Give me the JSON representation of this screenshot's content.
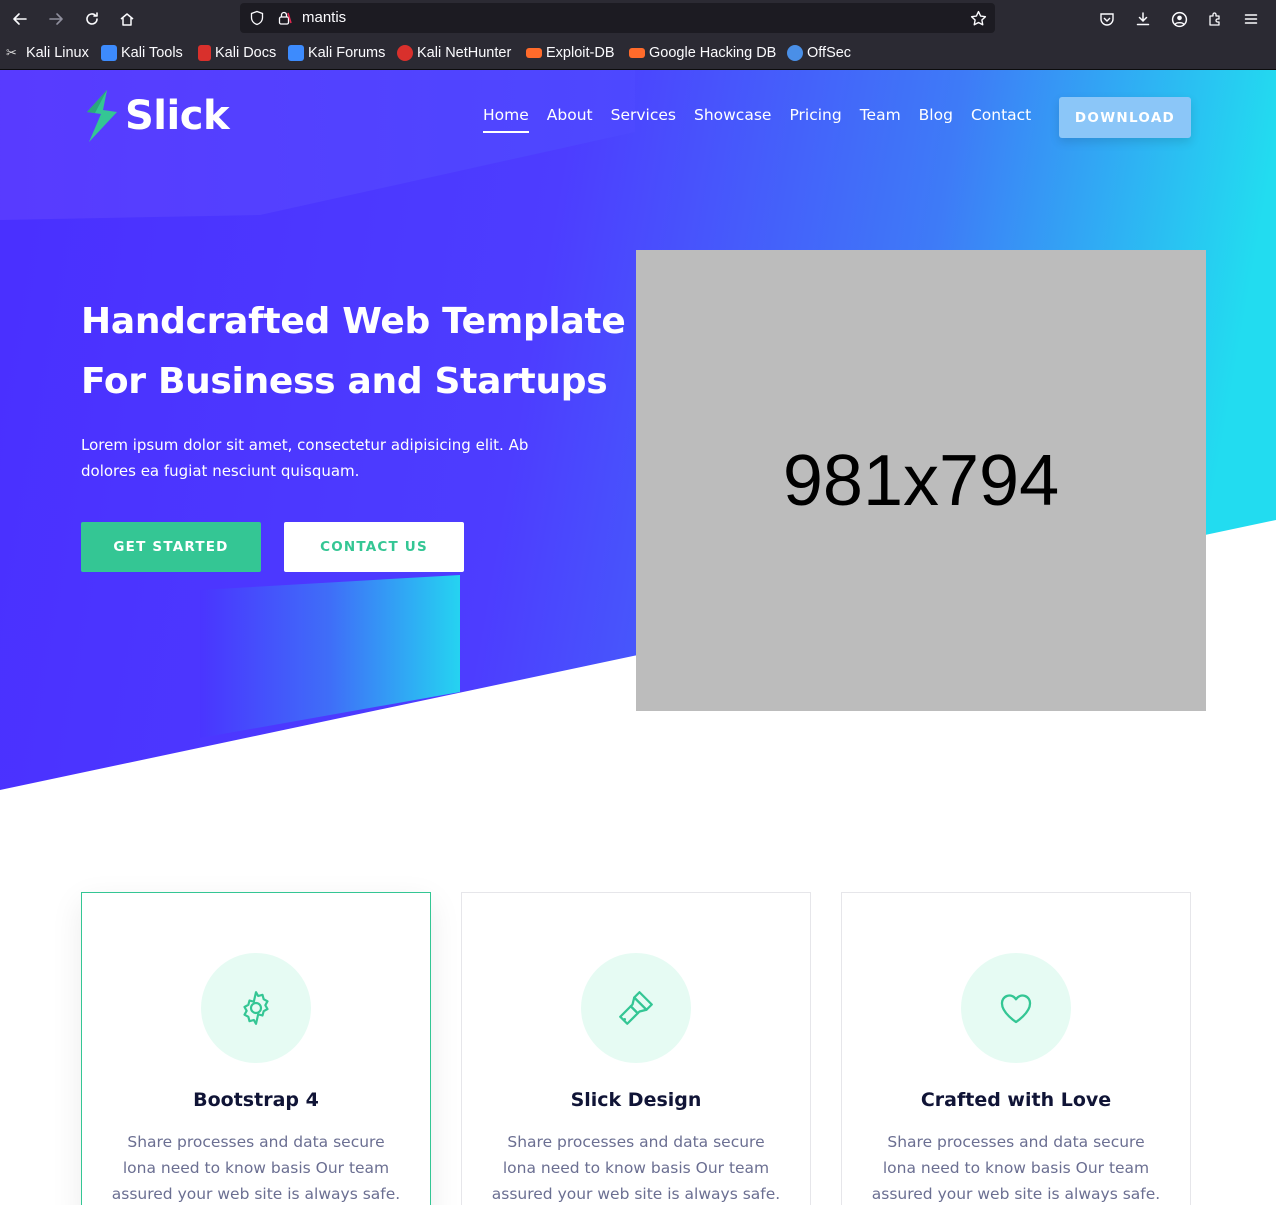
{
  "browser": {
    "url": "mantis",
    "bookmarks": [
      {
        "label": "Kali Linux",
        "color": "#dddddd"
      },
      {
        "label": "Kali Tools",
        "color": "#3d8bfd"
      },
      {
        "label": "Kali Docs",
        "color": "#d9302c"
      },
      {
        "label": "Kali Forums",
        "color": "#3d8bfd"
      },
      {
        "label": "Kali NetHunter",
        "color": "#d9302c"
      },
      {
        "label": "Exploit-DB",
        "color": "#ff6b2b"
      },
      {
        "label": "Google Hacking DB",
        "color": "#ff6b2b"
      },
      {
        "label": "OffSec",
        "color": "#4a8fe7"
      }
    ]
  },
  "header": {
    "logo_text": "Slick",
    "nav": [
      "Home",
      "About",
      "Services",
      "Showcase",
      "Pricing",
      "Team",
      "Blog",
      "Contact"
    ],
    "download_label": "DOWNLOAD"
  },
  "hero": {
    "title_line1": "Handcrafted Web Template",
    "title_line2": "For Business and Startups",
    "subtitle": "Lorem ipsum dolor sit amet, consectetur adipisicing elit. Ab dolores ea fugiat nesciunt quisquam.",
    "primary_cta": "GET STARTED",
    "secondary_cta": "CONTACT US",
    "image_placeholder": "981x794"
  },
  "features": [
    {
      "title": "Bootstrap 4",
      "text": "Share processes and data secure lona need to know basis Our team assured your web site is always safe.",
      "icon": "gear-icon"
    },
    {
      "title": "Slick Design",
      "text": "Share processes and data secure lona need to know basis Our team assured your web site is always safe.",
      "icon": "brush-icon"
    },
    {
      "title": "Crafted with Love",
      "text": "Share processes and data secure lona need to know basis Our team assured your web site is always safe.",
      "icon": "heart-icon"
    }
  ],
  "colors": {
    "accent": "#34c694",
    "hero_purple": "#4a2fff",
    "hero_cyan": "#23d9f0"
  }
}
